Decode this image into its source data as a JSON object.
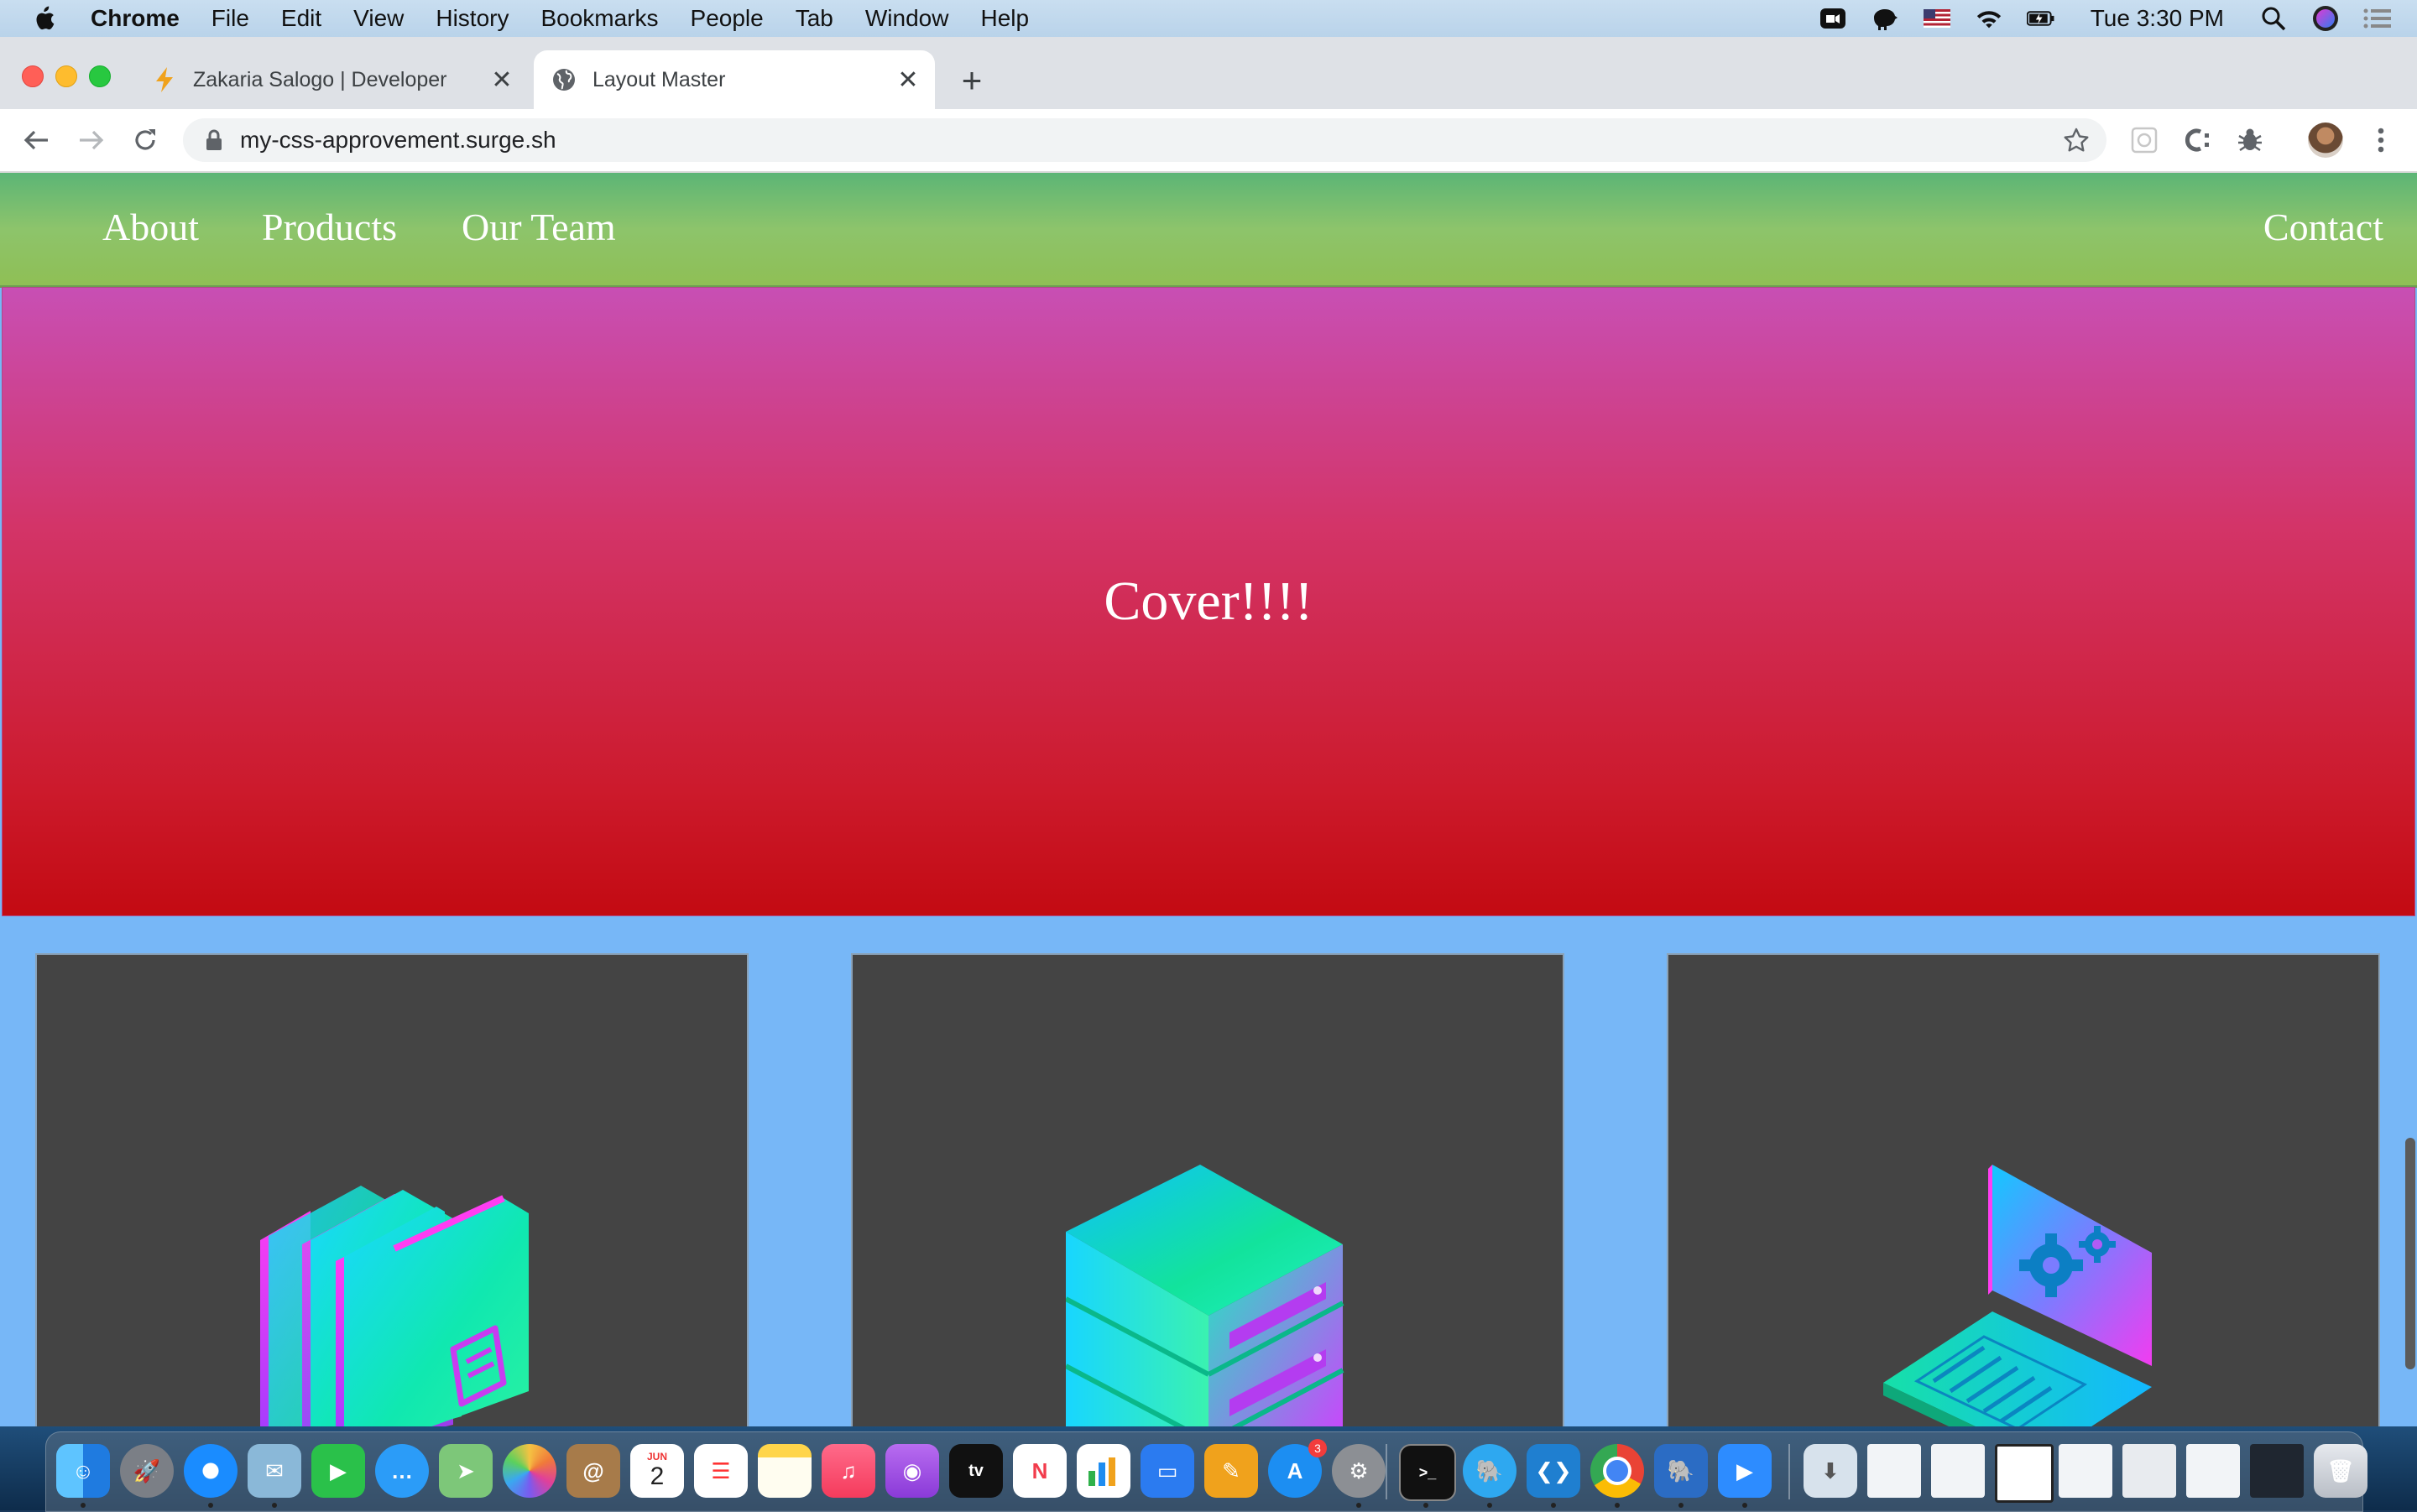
{
  "menubar": {
    "app_name": "Chrome",
    "items": [
      "File",
      "Edit",
      "View",
      "History",
      "Bookmarks",
      "People",
      "Tab",
      "Window",
      "Help"
    ],
    "clock": "Tue 3:30 PM",
    "status_icons": [
      "zoom-icon",
      "evernote-icon",
      "us-flag-icon",
      "wifi-icon",
      "battery-icon",
      "spotlight-icon",
      "siri-icon",
      "notification-center-icon"
    ]
  },
  "tabs": [
    {
      "title": "Zakaria Salogo | Developer",
      "favicon": "lightning-icon",
      "active": false
    },
    {
      "title": "Layout Master",
      "favicon": "globe-icon",
      "active": true
    }
  ],
  "toolbar": {
    "url": "my-css-approvement.surge.sh"
  },
  "nav": {
    "links": [
      "About",
      "Products",
      "Our Team"
    ],
    "contact": "Contact"
  },
  "cover": {
    "heading": "Cover!!!!"
  },
  "cards": [
    {
      "icon": "folders-icon"
    },
    {
      "icon": "server-icon"
    },
    {
      "icon": "laptop-settings-icon"
    }
  ],
  "dock": {
    "calendar_month": "JUN",
    "calendar_day": "2",
    "appstore_badge": "3"
  },
  "colors": {
    "nav_green": "#8dc46b",
    "cover_top": "#c84fb4",
    "cover_bottom": "#c30a12",
    "page_bg": "#77b7f7",
    "card_bg": "#444444"
  }
}
